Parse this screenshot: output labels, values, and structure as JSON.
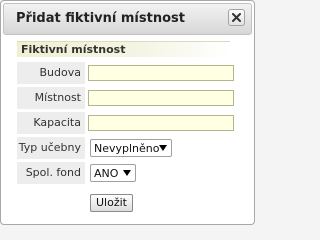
{
  "dialog": {
    "title": "Přidat fiktivní místnost",
    "close_icon": "close-x-icon"
  },
  "section": {
    "title": "Fiktivní místnost"
  },
  "form": {
    "building": {
      "label": "Budova",
      "value": ""
    },
    "room": {
      "label": "Místnost",
      "value": ""
    },
    "capacity": {
      "label": "Kapacita",
      "value": ""
    },
    "room_type": {
      "label": "Typ učebny",
      "selected": "Nevyplněno"
    },
    "shared_fund": {
      "label": "Spol. fond",
      "selected": "ANO"
    }
  },
  "actions": {
    "save_label": "Uložit"
  },
  "colors": {
    "input_background": "#ffffe3",
    "input_border": "#b5b58a",
    "label_background": "#ededed",
    "section_header": "#efefd2"
  }
}
